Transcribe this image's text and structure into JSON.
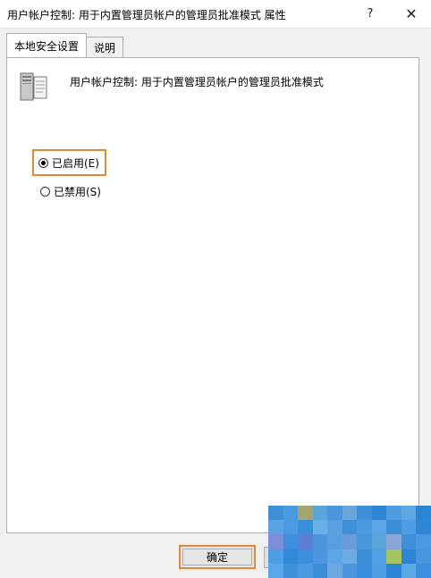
{
  "window": {
    "title": "用户帐户控制: 用于内置管理员帐户的管理员批准模式 属性",
    "help_label": "?",
    "close_label": "✕"
  },
  "tabs": [
    {
      "label": "本地安全设置",
      "active": true
    },
    {
      "label": "说明",
      "active": false
    }
  ],
  "policy": {
    "icon": "server-policy-icon",
    "title": "用户帐户控制: 用于内置管理员帐户的管理员批准模式"
  },
  "options": {
    "enabled_label": "已启用(E)",
    "disabled_label": "已禁用(S)",
    "selected": "enabled"
  },
  "buttons": {
    "ok_label": "确定"
  },
  "colors": {
    "highlight": "#e0893a",
    "mosaic": [
      "#3f8fd8",
      "#4a9ae0",
      "#a3a56a",
      "#5aa6d8",
      "#4b96dd",
      "#6aa4d9",
      "#3d8ed6",
      "#2f86d6",
      "#4d9ddf",
      "#5fa8e3",
      "#2e84d4",
      "#5ba3e4",
      "#4c9be2",
      "#3a8fdc",
      "#6ab0e8",
      "#5aa0df",
      "#3d90da",
      "#4a9ae0",
      "#5aa6e6",
      "#3a8ed8",
      "#4e9de3",
      "#2f86d6",
      "#7b8ed6",
      "#3c8fdc",
      "#5a7fd4",
      "#4b96dd",
      "#5a9de0",
      "#6b9bd8",
      "#4796de",
      "#5aa6d8",
      "#8aa6d4",
      "#3e8ed9",
      "#4a99e0",
      "#4d9ee6",
      "#2f8ad8",
      "#3c8fdc",
      "#4b96dd",
      "#5aa6e6",
      "#6aacdf",
      "#3b8ed8",
      "#50a0e4",
      "#a7c463",
      "#2d84d4",
      "#4795dc",
      "#5ba6e8",
      "#3e90da",
      "#4b9ae0",
      "#3a8dd8",
      "#6aa6e0",
      "#4b96dd",
      "#3a8fdc",
      "#4f9fe3",
      "#2f86d6",
      "#5aa8e6",
      "#3c8fdc"
    ]
  }
}
